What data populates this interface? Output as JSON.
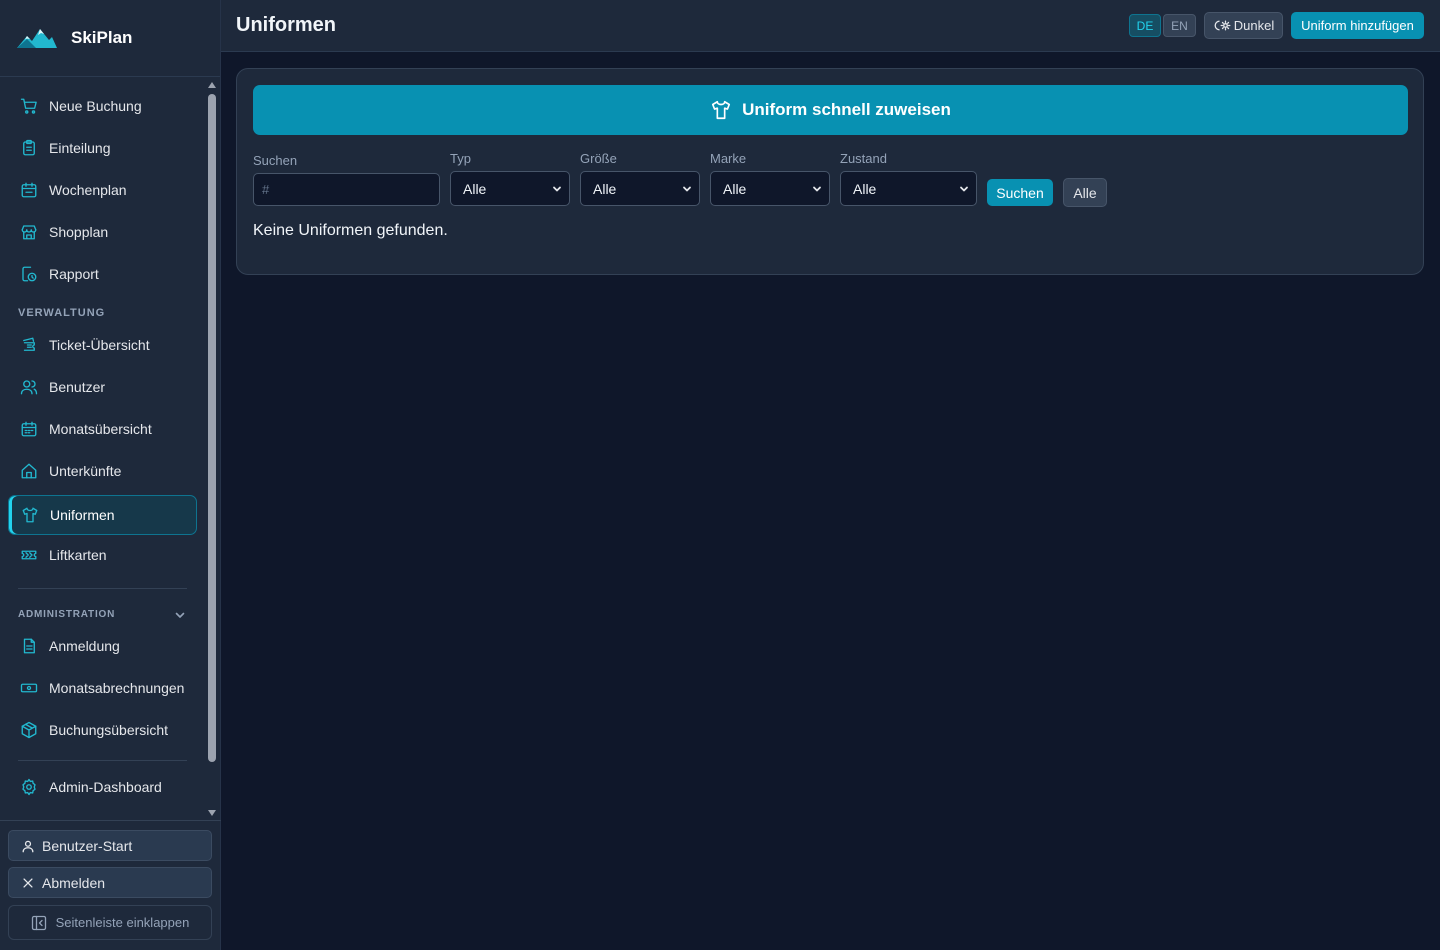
{
  "brand": {
    "name": "SkiPlan"
  },
  "nav": {
    "main": [
      {
        "label": "Neue Buchung",
        "icon": "cart-icon"
      },
      {
        "label": "Einteilung",
        "icon": "clipboard-icon"
      },
      {
        "label": "Wochenplan",
        "icon": "calendar-icon"
      },
      {
        "label": "Shopplan",
        "icon": "store-icon"
      },
      {
        "label": "Rapport",
        "icon": "report-clock-icon"
      }
    ],
    "verwaltung_label": "VERWALTUNG",
    "verwaltung": [
      {
        "label": "Ticket-Übersicht",
        "icon": "ticket-stack-icon"
      },
      {
        "label": "Benutzer",
        "icon": "users-icon"
      },
      {
        "label": "Monatsübersicht",
        "icon": "calendar-grid-icon"
      },
      {
        "label": "Unterkünfte",
        "icon": "home-icon"
      },
      {
        "label": "Uniformen",
        "icon": "shirt-icon",
        "active": true
      },
      {
        "label": "Liftkarten",
        "icon": "lift-ticket-icon"
      }
    ],
    "administration_label": "ADMINISTRATION",
    "administration": [
      {
        "label": "Anmeldung",
        "icon": "document-icon"
      },
      {
        "label": "Monatsabrechnungen",
        "icon": "banknote-icon"
      },
      {
        "label": "Buchungsübersicht",
        "icon": "box-icon"
      }
    ],
    "admin_dashboard": {
      "label": "Admin-Dashboard",
      "icon": "gear-icon"
    }
  },
  "bottom": {
    "user_start": "Benutzer-Start",
    "logout": "Abmelden",
    "collapse": "Seitenleiste einklappen"
  },
  "header": {
    "title": "Uniformen",
    "lang_de": "DE",
    "lang_en": "EN",
    "active_lang": "DE",
    "theme_label": "Dunkel",
    "add_button": "Uniform hinzufügen"
  },
  "main": {
    "quick_assign": "Uniform schnell zuweisen",
    "filters": {
      "search_label": "Suchen",
      "search_placeholder": "#",
      "search_value": "",
      "type_label": "Typ",
      "type_value": "Alle",
      "size_label": "Größe",
      "size_value": "Alle",
      "brand_label": "Marke",
      "brand_value": "Alle",
      "condition_label": "Zustand",
      "condition_value": "Alle",
      "search_button": "Suchen",
      "all_button": "Alle"
    },
    "empty_message": "Keine Uniformen gefunden."
  },
  "colors": {
    "accent": "#0891b2",
    "accent_light": "#22d3ee",
    "background": "#0f172a",
    "panel": "#1e293b"
  }
}
